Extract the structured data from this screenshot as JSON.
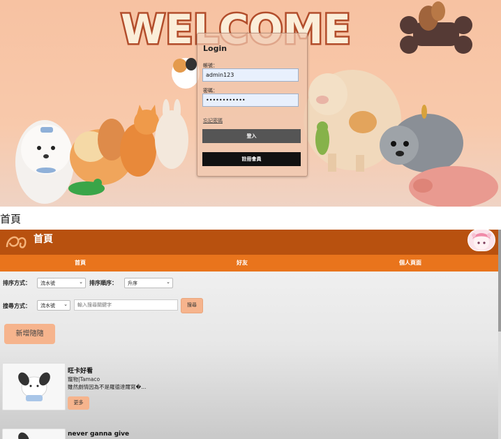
{
  "hero": {
    "welcome": "WELCOME",
    "login": {
      "title": "Login",
      "account_label": "帳號：",
      "account_value": "admin123",
      "password_label": "密碼：",
      "password_value": "••••••••••••",
      "forgot": "忘記密碼",
      "login_button": "登入",
      "register_button": "註冊會員"
    }
  },
  "caption": "首頁",
  "app": {
    "title": "首頁",
    "nav": [
      "首頁",
      "好友",
      "個人頁面"
    ],
    "sort_label": "排序方式：",
    "sort_value": "流水號",
    "order_label": "排序順序：",
    "order_value": "升序",
    "search_label": "搜尋方式：",
    "search_type_value": "流水號",
    "search_placeholder": "輸入搜尋關鍵字",
    "search_button": "搜尋",
    "add_button": "新增隨隨",
    "cards": [
      {
        "title": "旺卡好看",
        "meta": "寵物|Tamaco",
        "desc": "雖然劇情因為不是羅德達爾寫�...",
        "more": "更多"
      },
      {
        "title": "never ganna give"
      }
    ]
  },
  "colors": {
    "topbar": "#b8510f",
    "navbar": "#e9741c",
    "accent_button": "#f6b48d",
    "hero_bg": "#f7c2a2"
  }
}
